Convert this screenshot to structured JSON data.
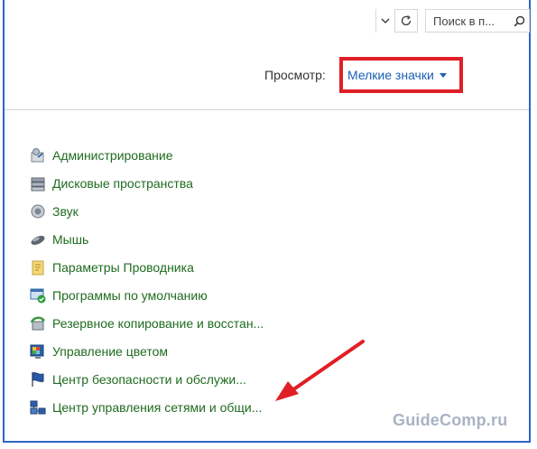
{
  "toolbar": {
    "search_placeholder": "Поиск в п..."
  },
  "view": {
    "label": "Просмотр:",
    "value": "Мелкие значки"
  },
  "items": [
    {
      "label": "Администрирование",
      "icon": "admin-tools-icon"
    },
    {
      "label": "Дисковые пространства",
      "icon": "storage-spaces-icon"
    },
    {
      "label": "Звук",
      "icon": "speaker-icon"
    },
    {
      "label": "Мышь",
      "icon": "mouse-icon"
    },
    {
      "label": "Параметры Проводника",
      "icon": "folder-options-icon"
    },
    {
      "label": "Программы по умолчанию",
      "icon": "default-programs-icon"
    },
    {
      "label": "Резервное копирование и восстан...",
      "icon": "backup-icon"
    },
    {
      "label": "Управление цветом",
      "icon": "color-management-icon"
    },
    {
      "label": "Центр безопасности и обслужи...",
      "icon": "security-center-flag-icon"
    },
    {
      "label": "Центр управления сетями и общи...",
      "icon": "network-center-icon"
    }
  ],
  "watermark": "GuideComp.ru",
  "colors": {
    "frame_border": "#2f63c9",
    "highlight": "#e01e26",
    "link": "#1f6b1f",
    "accent_blue": "#1a5fb4"
  }
}
